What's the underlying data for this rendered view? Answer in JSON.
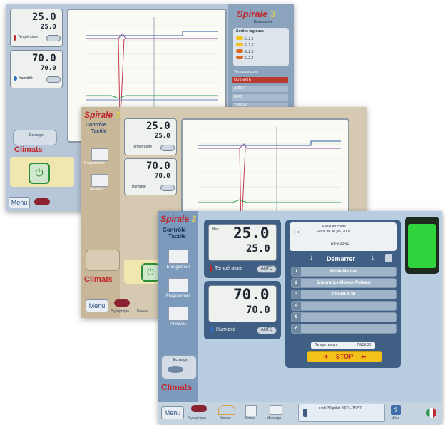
{
  "colors": {
    "accent_red": "#c0282c",
    "panel_blue": "#3f5f84",
    "stop_yellow": "#f2c21b",
    "status_green": "#2fd43c"
  },
  "back_screen": {
    "temp_value": "25.0",
    "temp_setpoint": "25.0",
    "temp_label": "Température",
    "hum_value": "70.0",
    "hum_setpoint": "70.0",
    "hum_label": "Humidité",
    "brand": "Spirale",
    "brand_num": "3",
    "brand_sub": "Ensemencé",
    "panel_title": "Sorties logiques",
    "outputs": [
      "SL2.5",
      "SL2.6",
      "SL2.3",
      "SL2.4"
    ],
    "door_title": "Verrou de porte",
    "menu_items": [
      "OUVERTE",
      "ARRÊT",
      "G-F1",
      "TUBE46"
    ],
    "climats": "Climats",
    "menu": "Menu",
    "echange_label": "Echange"
  },
  "mid_screen": {
    "brand": "Spirale",
    "brand_num": "3",
    "subtitle_1": "Contrôle",
    "subtitle_2": "Tactile",
    "temp_value": "25.0",
    "temp_setpoint": "25.0",
    "temp_label": "Température",
    "hum_value": "70.0",
    "hum_setpoint": "70.0",
    "hum_label": "Humidité",
    "side": [
      "Programmes",
      "Archives"
    ],
    "climats": "Climats",
    "menu": "Menu",
    "toolbar": [
      "Synoptique",
      "Niveau"
    ]
  },
  "front_screen": {
    "brand": "Spirale",
    "brand_num": "3",
    "subtitle_1": "Contrôle",
    "subtitle_2": "Tactile",
    "side": [
      "Enregistreur",
      "Programmes",
      "Archives"
    ],
    "echange_label": "Echange",
    "climats": "Climats",
    "temp_small": "Mes",
    "temp_value": "25.0",
    "temp_setpoint": "25.0",
    "temp_label": "Température",
    "hum_value": "70.0",
    "hum_setpoint": "70.0",
    "hum_label": "Humidité",
    "toggle_label": "AUTO",
    "essai_line1": "Essai en cours",
    "essai_line2": "Essai du 30 juil. 2007",
    "essai_code": "EB-2-30-v1",
    "demarrer": "Démarrer",
    "sequences": [
      {
        "num": "1",
        "label": "Mode Manuel"
      },
      {
        "num": "2",
        "label": "Endurance Moteur Pulseur"
      },
      {
        "num": "3",
        "label": "CEI-68-2-30"
      },
      {
        "num": "4",
        "label": ""
      },
      {
        "num": "5",
        "label": ""
      },
      {
        "num": "6",
        "label": ""
      }
    ],
    "timer_label": "Temps restant",
    "timer_value": "7W19:00",
    "stop": "STOP",
    "menu": "Menu",
    "toolbar": [
      "Synoptique",
      "Niveau",
      "Notes",
      "Message"
    ],
    "datetime": "lundi 30 juillet 2007 - 15:57",
    "help": "Aide"
  }
}
